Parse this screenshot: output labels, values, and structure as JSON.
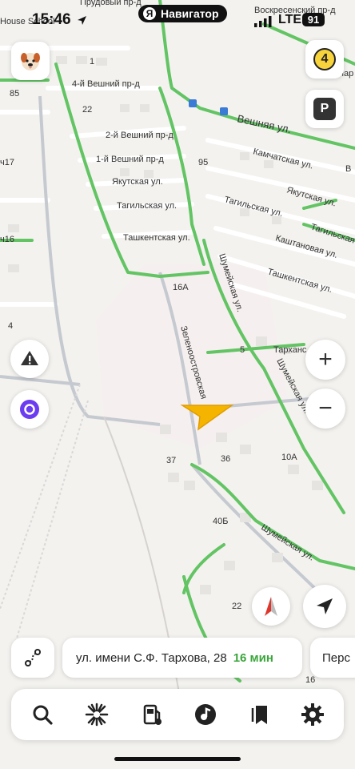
{
  "status_bar": {
    "time": "15:46",
    "app_pill_logo": "Я",
    "app_pill_label": "Навигатор",
    "network": "LTE",
    "battery": "91"
  },
  "map": {
    "labels": {
      "school": "House School",
      "vosk": "Воскресенский пр-д",
      "prud": "Прудовый пр-д",
      "pare": "пар",
      "n85": "85",
      "n1": "1",
      "n22": "22",
      "n95": "95",
      "ch17": "ч17",
      "ch16": "ч16",
      "n4": "4",
      "n16a": "16А",
      "n5": "5",
      "n37": "37",
      "n36": "36",
      "n10a": "10А",
      "n40b": "40Б",
      "n22b": "22",
      "n16": "16",
      "vesh4": "4-й Вешний пр-д",
      "vesh2": "2-й Вешний пр-д",
      "vesh1": "1-й Вешний пр-д",
      "vesh": "Вешняя ул.",
      "yak": "Якутская ул.",
      "yak2": "Якутская ул.",
      "tag": "Тагильская ул.",
      "tag2": "Тагильская ул.",
      "tag3": "Тагильская",
      "tash": "Ташкентская ул.",
      "tash2": "Ташкентская ул.",
      "kam": "Камчатская ул.",
      "kash": "Каштановая ул.",
      "shum": "Шумейская ул.",
      "shum2": "Шумейская ул.",
      "shum3": "Шумейская ул.",
      "zel": "Зеленоостровская",
      "tarkh": "Тарханс",
      "vshort": "В"
    }
  },
  "controls": {
    "weather_value": "4",
    "parking_label": "P",
    "zoom_in": "+",
    "zoom_out": "−"
  },
  "destination": {
    "address": "ул. имени С.Ф. Тархова, 28",
    "eta": "16 мин",
    "next_card": "Перс"
  },
  "toolbar_icons": [
    "search-icon",
    "discovery-icon",
    "gas-station-icon",
    "music-icon",
    "bookmarks-icon",
    "settings-icon"
  ],
  "colors": {
    "route_green": "#63c464",
    "nav_arrow": "#f5b400",
    "eta_green": "#3aa53a",
    "alice_purple": "#6b3cf0"
  }
}
